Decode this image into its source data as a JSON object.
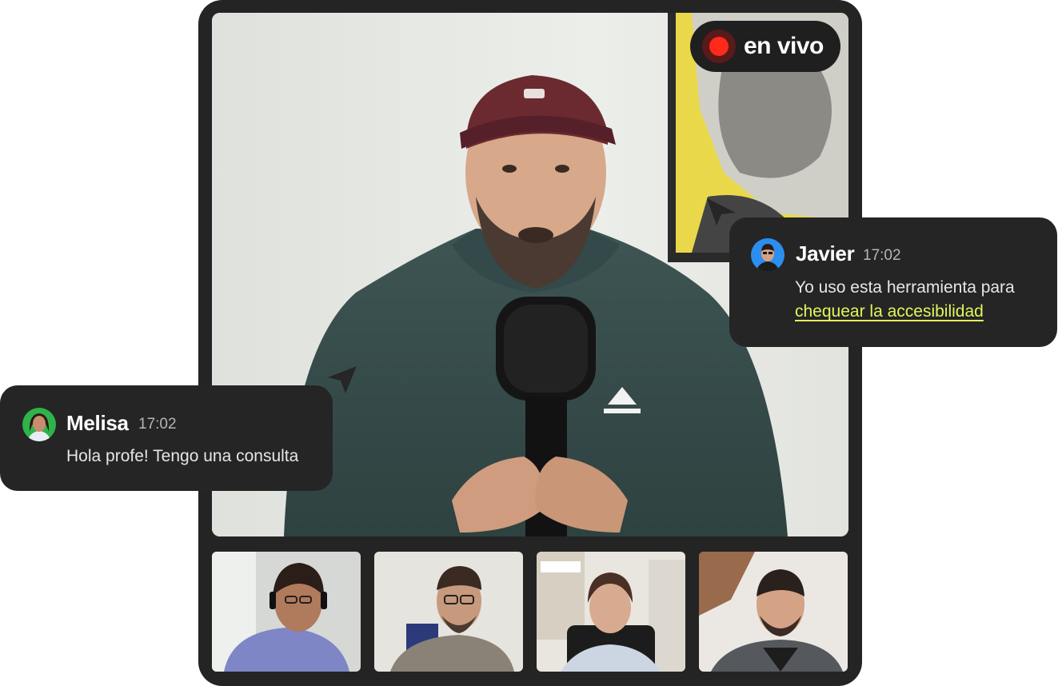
{
  "live_badge": {
    "label": "en vivo"
  },
  "messages": [
    {
      "name": "Javier",
      "time": "17:02",
      "text_line1": "Yo uso esta herramienta para",
      "link_text": "chequear la accesibilidad"
    },
    {
      "name": "Melisa",
      "time": "17:02",
      "text": "Hola profe! Tengo una consulta"
    }
  ],
  "participants_count": 4,
  "colors": {
    "frame": "#242424",
    "bubble": "#252525",
    "accent_link": "#e4f55a",
    "record": "#ff2a1a"
  }
}
